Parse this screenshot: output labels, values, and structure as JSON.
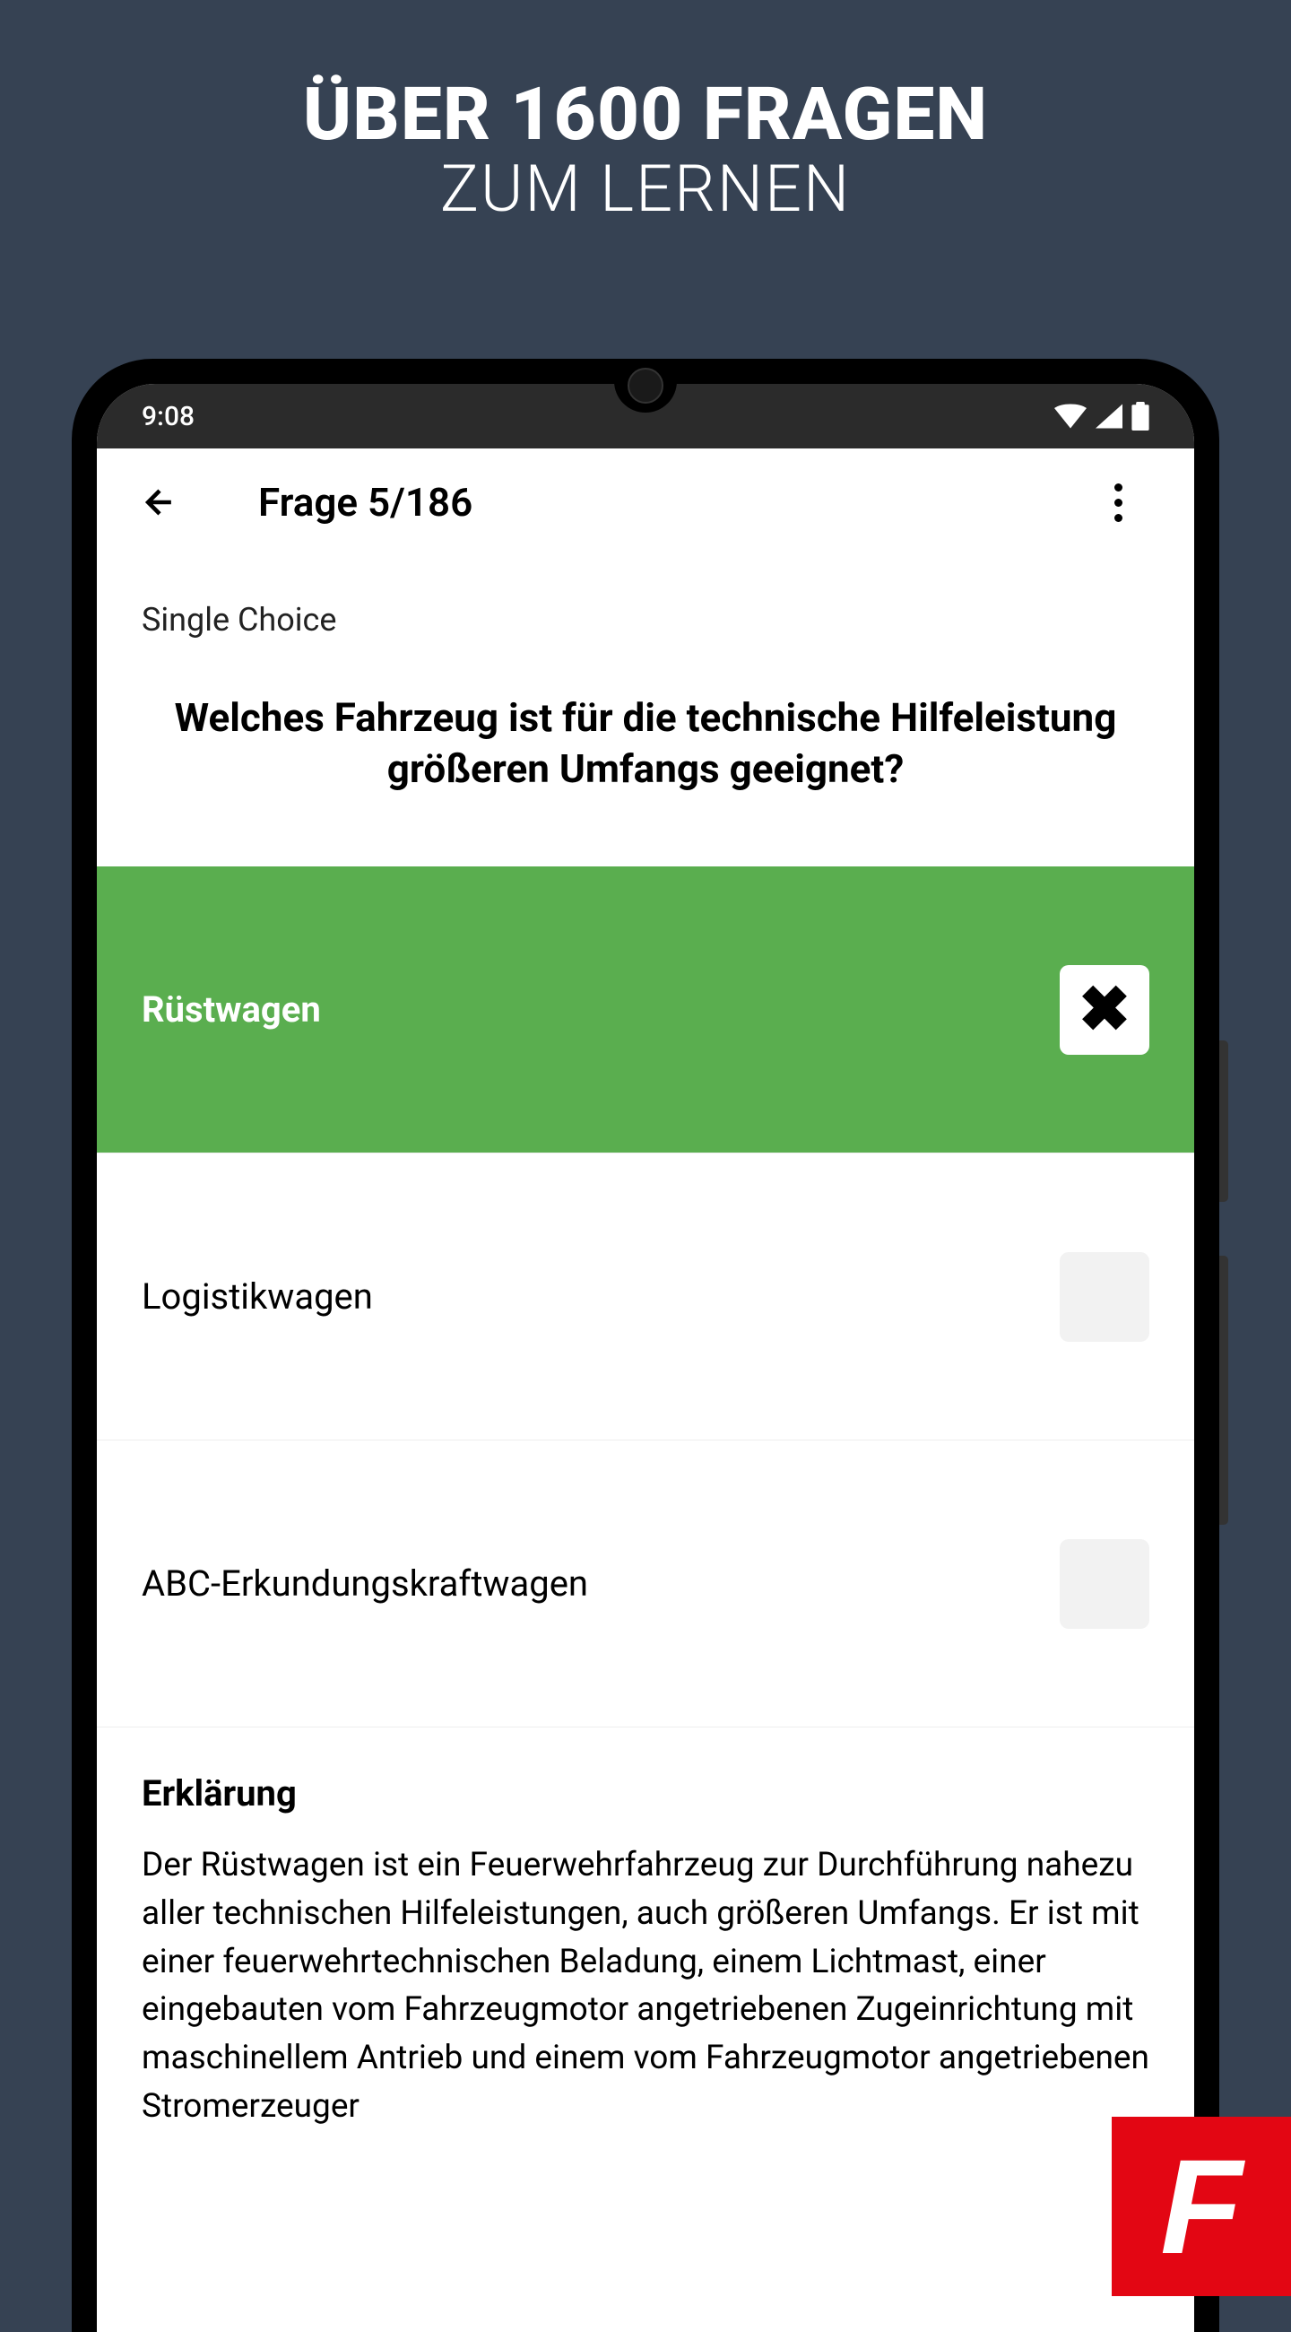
{
  "promo": {
    "title": "ÜBER 1600 FRAGEN",
    "subtitle": "ZUM LERNEN"
  },
  "statusBar": {
    "time": "9:08"
  },
  "header": {
    "title": "Frage 5/186"
  },
  "question": {
    "type": "Single Choice",
    "text": "Welches Fahrzeug ist für die technische Hilfeleistung größeren Umfangs geeignet?"
  },
  "answers": [
    {
      "label": "Rüstwagen",
      "correct": true,
      "marked": true
    },
    {
      "label": "Logistikwagen",
      "correct": false,
      "marked": false
    },
    {
      "label": "ABC-Erkundungskraftwagen",
      "correct": false,
      "marked": false
    }
  ],
  "explanation": {
    "title": "Erklärung",
    "text": "Der Rüstwagen ist ein Feuerwehrfahrzeug zur Durchführung nahezu aller technischen Hilfeleistungen, auch größeren Umfangs. Er ist mit einer feuerwehrtechnischen Beladung, einem Lichtmast, einer eingebauten vom Fahrzeugmotor angetriebenen Zugeinrichtung mit maschinellem Antrieb und einem vom Fahrzeugmotor angetriebenen Stromerzeuger"
  },
  "badge": {
    "letter": "F"
  }
}
